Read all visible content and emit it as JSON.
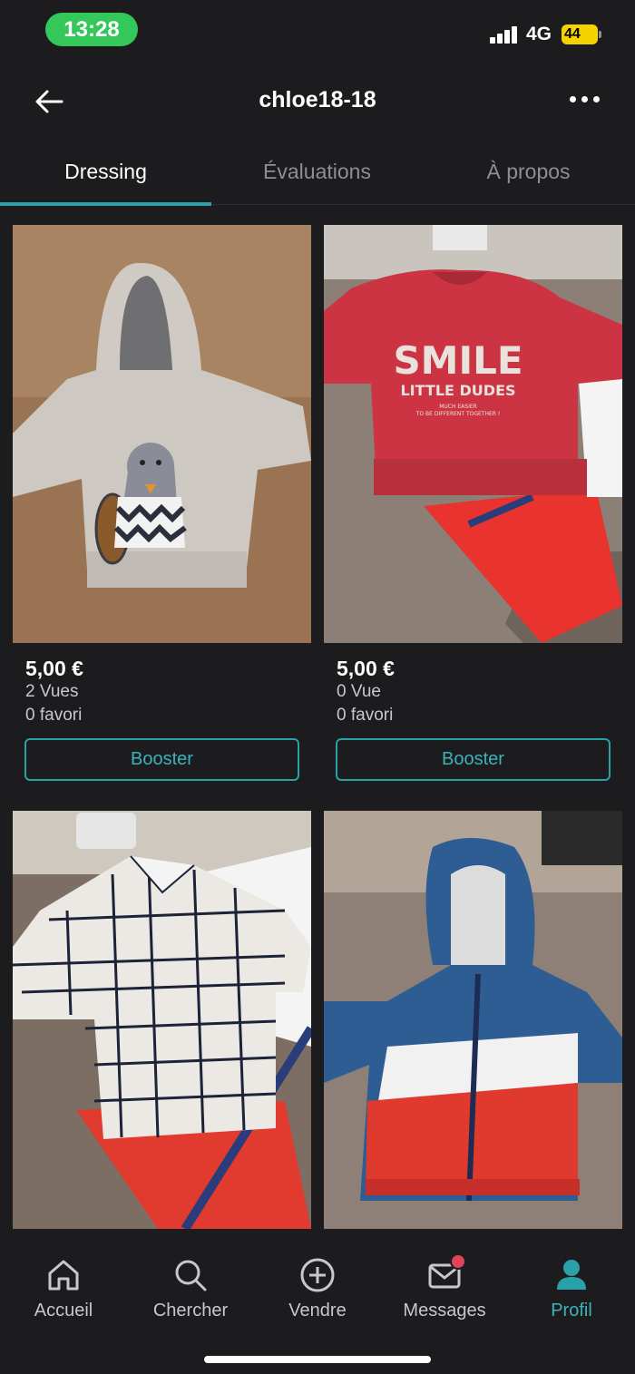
{
  "status_bar": {
    "time": "13:28",
    "network": "4G",
    "battery": "44"
  },
  "header": {
    "title": "chloe18-18"
  },
  "tabs": [
    {
      "label": "Dressing",
      "active": true
    },
    {
      "label": "Évaluations",
      "active": false
    },
    {
      "label": "À propos",
      "active": false
    }
  ],
  "items": [
    {
      "price": "5,00 €",
      "views": "2 Vues",
      "favorites": "0 favori",
      "boost_label": "Booster",
      "photo": "grey-knit-hoodie-beaver-icon"
    },
    {
      "price": "5,00 €",
      "views": "0 Vue",
      "favorites": "0 favori",
      "boost_label": "Booster",
      "photo": "red-smile-sweatshirt-icon"
    },
    {
      "photo": "checked-shirt-red-shorts-icon"
    },
    {
      "photo": "blue-white-red-windbreaker-icon"
    }
  ],
  "photo_labels": {
    "sweatshirt_line1": "SMILE",
    "sweatshirt_line2": "LITTLE DUDES",
    "sweatshirt_line3": "MUCH EASIER",
    "sweatshirt_line4": "TO BE DIFFERENT TOGETHER !"
  },
  "bottom_nav": [
    {
      "label": "Accueil",
      "icon": "home-icon",
      "active": false
    },
    {
      "label": "Chercher",
      "icon": "search-icon",
      "active": false
    },
    {
      "label": "Vendre",
      "icon": "plus-circle-icon",
      "active": false
    },
    {
      "label": "Messages",
      "icon": "mail-icon",
      "active": false,
      "badge": true
    },
    {
      "label": "Profil",
      "icon": "person-icon",
      "active": true
    }
  ],
  "colors": {
    "accent": "#2aa1a8",
    "background": "#1c1c1e",
    "time_pill": "#34c759",
    "badge": "#e0445a"
  }
}
